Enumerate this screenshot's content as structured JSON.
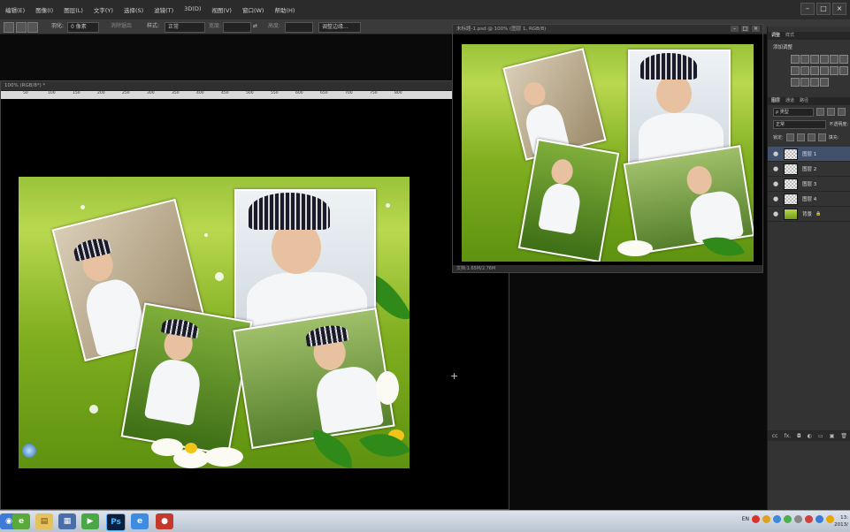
{
  "menubar": {
    "items": [
      "编辑(E)",
      "图像(I)",
      "图层(L)",
      "文字(Y)",
      "选择(S)",
      "滤镜(T)",
      "3D(D)",
      "视图(V)",
      "窗口(W)",
      "帮助(H)"
    ],
    "window_buttons": [
      "–",
      "□",
      "×"
    ]
  },
  "options": {
    "feather_label": "羽化:",
    "feather_value": "0 像素",
    "antialias_label": "消除锯齿",
    "style_label": "样式:",
    "style_value": "正常",
    "width_label": "宽度:",
    "height_label": "高度:",
    "refine_edge": "调整边缘..."
  },
  "doc_main": {
    "title": "100% (RGB/8*) *",
    "ruler_numbers": [
      "50",
      "100",
      "150",
      "200",
      "250",
      "300",
      "350",
      "400",
      "450",
      "500",
      "550",
      "600",
      "650",
      "700",
      "750",
      "800"
    ]
  },
  "doc_secondary": {
    "title": "未标题-1.psd @ 100% (图层 1, RGB/8)",
    "status": "文档:1.65M/2.76M",
    "buttons": [
      "–",
      "□",
      "×"
    ]
  },
  "panels": {
    "top_tabs": [
      "调整",
      "样式"
    ],
    "adjustments_label": "添加调整",
    "layer_tabs": [
      "图层",
      "通道",
      "路径"
    ],
    "kind_filter": "ρ 类型",
    "blend_mode": "正常",
    "opacity_label": "不透明度:",
    "lock_label": "锁定:",
    "fill_label": "填充:",
    "layers": [
      {
        "name": "图层 1",
        "selected": true,
        "background": false
      },
      {
        "name": "图层 2",
        "selected": false,
        "background": false
      },
      {
        "name": "图层 3",
        "selected": false,
        "background": false
      },
      {
        "name": "图层 4",
        "selected": false,
        "background": false
      },
      {
        "name": "背景",
        "selected": false,
        "background": true
      }
    ],
    "footer_icons": [
      "ⅽⅽ",
      "fx.",
      "◘",
      "◐",
      "▭",
      "▣",
      "🗑"
    ]
  },
  "taskbar": {
    "tray_text": "EN",
    "clock_time": "13:",
    "clock_date": "2013/"
  },
  "colors": {
    "canvas_green": "#7fae1f",
    "selected_layer": "#41506b",
    "workspace": "#0a0a0a"
  }
}
